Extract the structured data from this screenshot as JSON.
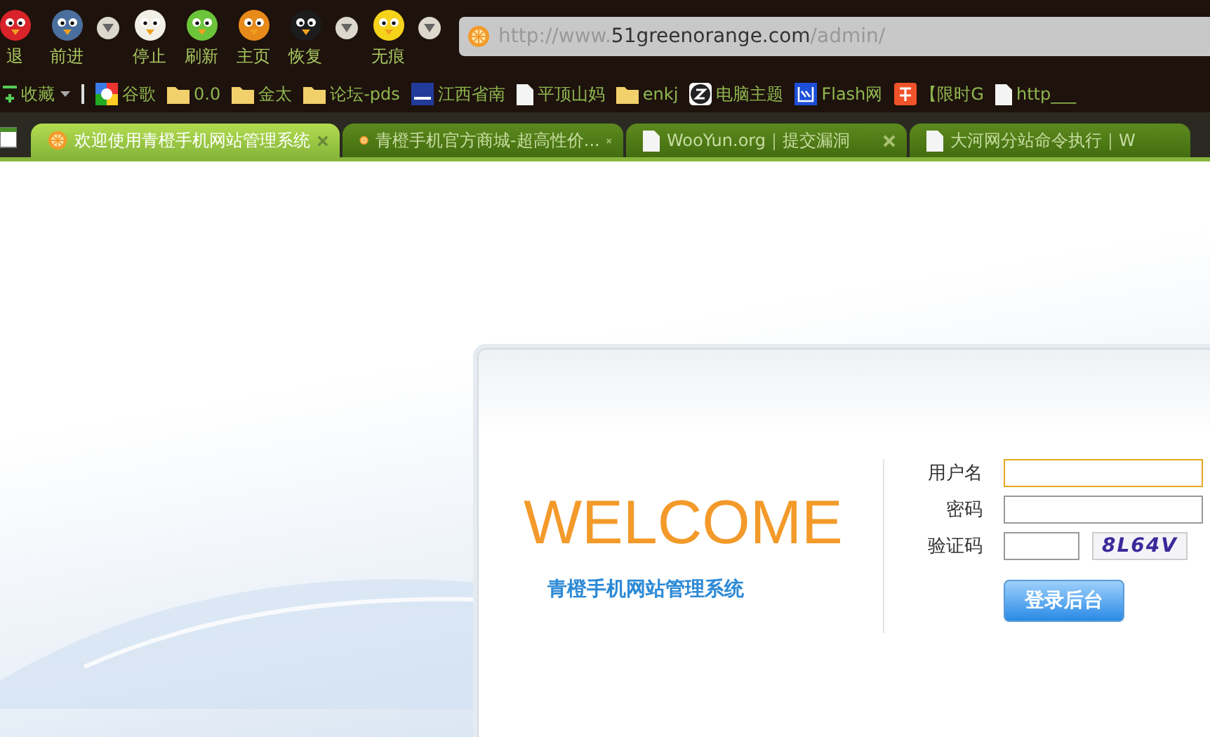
{
  "toolbar": {
    "buttons": [
      {
        "label": "退",
        "kind": "bird",
        "color": "#d8232a"
      },
      {
        "label": "前进",
        "kind": "bird",
        "color": "#4a6f9e"
      },
      {
        "kind": "dropdown"
      },
      {
        "label": "停止",
        "kind": "bird",
        "color": "#f2f0e6"
      },
      {
        "label": "刷新",
        "kind": "bird",
        "color": "#6cc43a"
      },
      {
        "label": "主页",
        "kind": "bird",
        "color": "#e88a1a"
      },
      {
        "label": "恢复",
        "kind": "bird",
        "color": "#1c1c1c"
      },
      {
        "kind": "dropdown"
      },
      {
        "label": "无痕",
        "kind": "bird",
        "color": "#f5d31a"
      },
      {
        "kind": "dropdown"
      }
    ]
  },
  "address_bar": {
    "prefix": "http://www.",
    "host": "51greenorange.com",
    "path": "/admin/"
  },
  "bookmarks": [
    {
      "label": "收藏",
      "kind": "favorites"
    },
    {
      "label": "谷歌",
      "kind": "google"
    },
    {
      "label": "0.0",
      "kind": "folder"
    },
    {
      "label": "金太",
      "kind": "folder"
    },
    {
      "label": "论坛-pds",
      "kind": "folder"
    },
    {
      "label": "江西省南",
      "kind": "site"
    },
    {
      "label": "平顶山妈",
      "kind": "page"
    },
    {
      "label": "enkj",
      "kind": "folder"
    },
    {
      "label": "电脑主题",
      "kind": "zicon"
    },
    {
      "label": "Flash网",
      "kind": "wang"
    },
    {
      "label": "【限时G",
      "kind": "tao"
    },
    {
      "label": "http___",
      "kind": "page"
    }
  ],
  "tabs": [
    {
      "title": "欢迎使用青橙手机网站管理系统",
      "selected": true,
      "kind": "orange",
      "closable": true
    },
    {
      "title": "青橙手机官方商城-超高性价...",
      "selected": false,
      "kind": "orange",
      "closable": true
    },
    {
      "title": "WooYun.org｜提交漏洞",
      "selected": false,
      "kind": "page",
      "closable": true
    },
    {
      "title": "大河网分站命令执行｜W",
      "selected": false,
      "kind": "page",
      "closable": false
    }
  ],
  "login": {
    "welcome": "WELCOME",
    "subtitle": "青橙手机网站管理系统",
    "fields": [
      {
        "label": "用户名",
        "kind": "text",
        "focused": true
      },
      {
        "label": "密码",
        "kind": "password",
        "focused": false
      },
      {
        "label": "验证码",
        "kind": "captcha",
        "focused": false,
        "captcha": "8L64V"
      }
    ],
    "submit": "登录后台"
  }
}
